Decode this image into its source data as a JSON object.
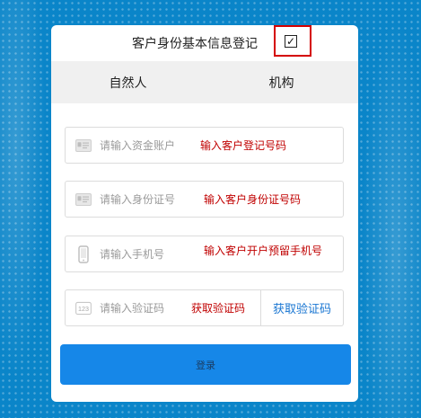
{
  "header": {
    "title": "客户身份基本信息登记",
    "checkbox_checked": true,
    "checkbox_glyph": "✓"
  },
  "tabs": [
    {
      "label": "自然人"
    },
    {
      "label": "机构"
    }
  ],
  "fields": [
    {
      "icon": "id-card-icon",
      "placeholder": "请输入资金账户",
      "annotation": "输入客户登记号码"
    },
    {
      "icon": "id-card-icon",
      "placeholder": "请输入身份证号",
      "annotation": "输入客户身份证号码"
    },
    {
      "icon": "mobile-phone-icon",
      "placeholder": "请输入手机号",
      "annotation": "输入客户开户预留手机号"
    },
    {
      "icon": "verification-code-icon",
      "placeholder": "请输入验证码",
      "annotation": "获取验证码",
      "icon_text": "123"
    }
  ],
  "get_code_button": {
    "label": "获取验证码"
  },
  "login_button": {
    "label": "登录"
  },
  "colors": {
    "background": "#0b84c9",
    "accent_red": "#d40000",
    "primary_button": "#1687e8",
    "link_blue": "#1976d2"
  }
}
